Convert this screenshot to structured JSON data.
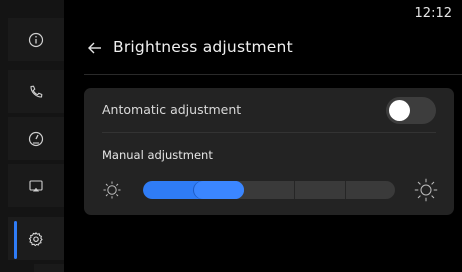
{
  "status_bar": {
    "time": "12:12"
  },
  "sidebar": {
    "items": [
      {
        "icon": "info-icon"
      },
      {
        "icon": "phone-icon"
      },
      {
        "icon": "dashboard-gauge-icon"
      },
      {
        "icon": "cast-screen-icon"
      },
      {
        "icon": "gear-icon",
        "active": true
      }
    ]
  },
  "header": {
    "title": "Brightness adjustment",
    "back_icon": "arrow-left-icon"
  },
  "settings": {
    "auto_label": "Antomatic adjustment",
    "auto_enabled": false,
    "manual_label": "Manual adjustment",
    "brightness_level": 0.4,
    "brightness_segments": 5
  },
  "colors": {
    "accent": "#2f7cf6",
    "background": "#000000",
    "card": "#232323"
  }
}
